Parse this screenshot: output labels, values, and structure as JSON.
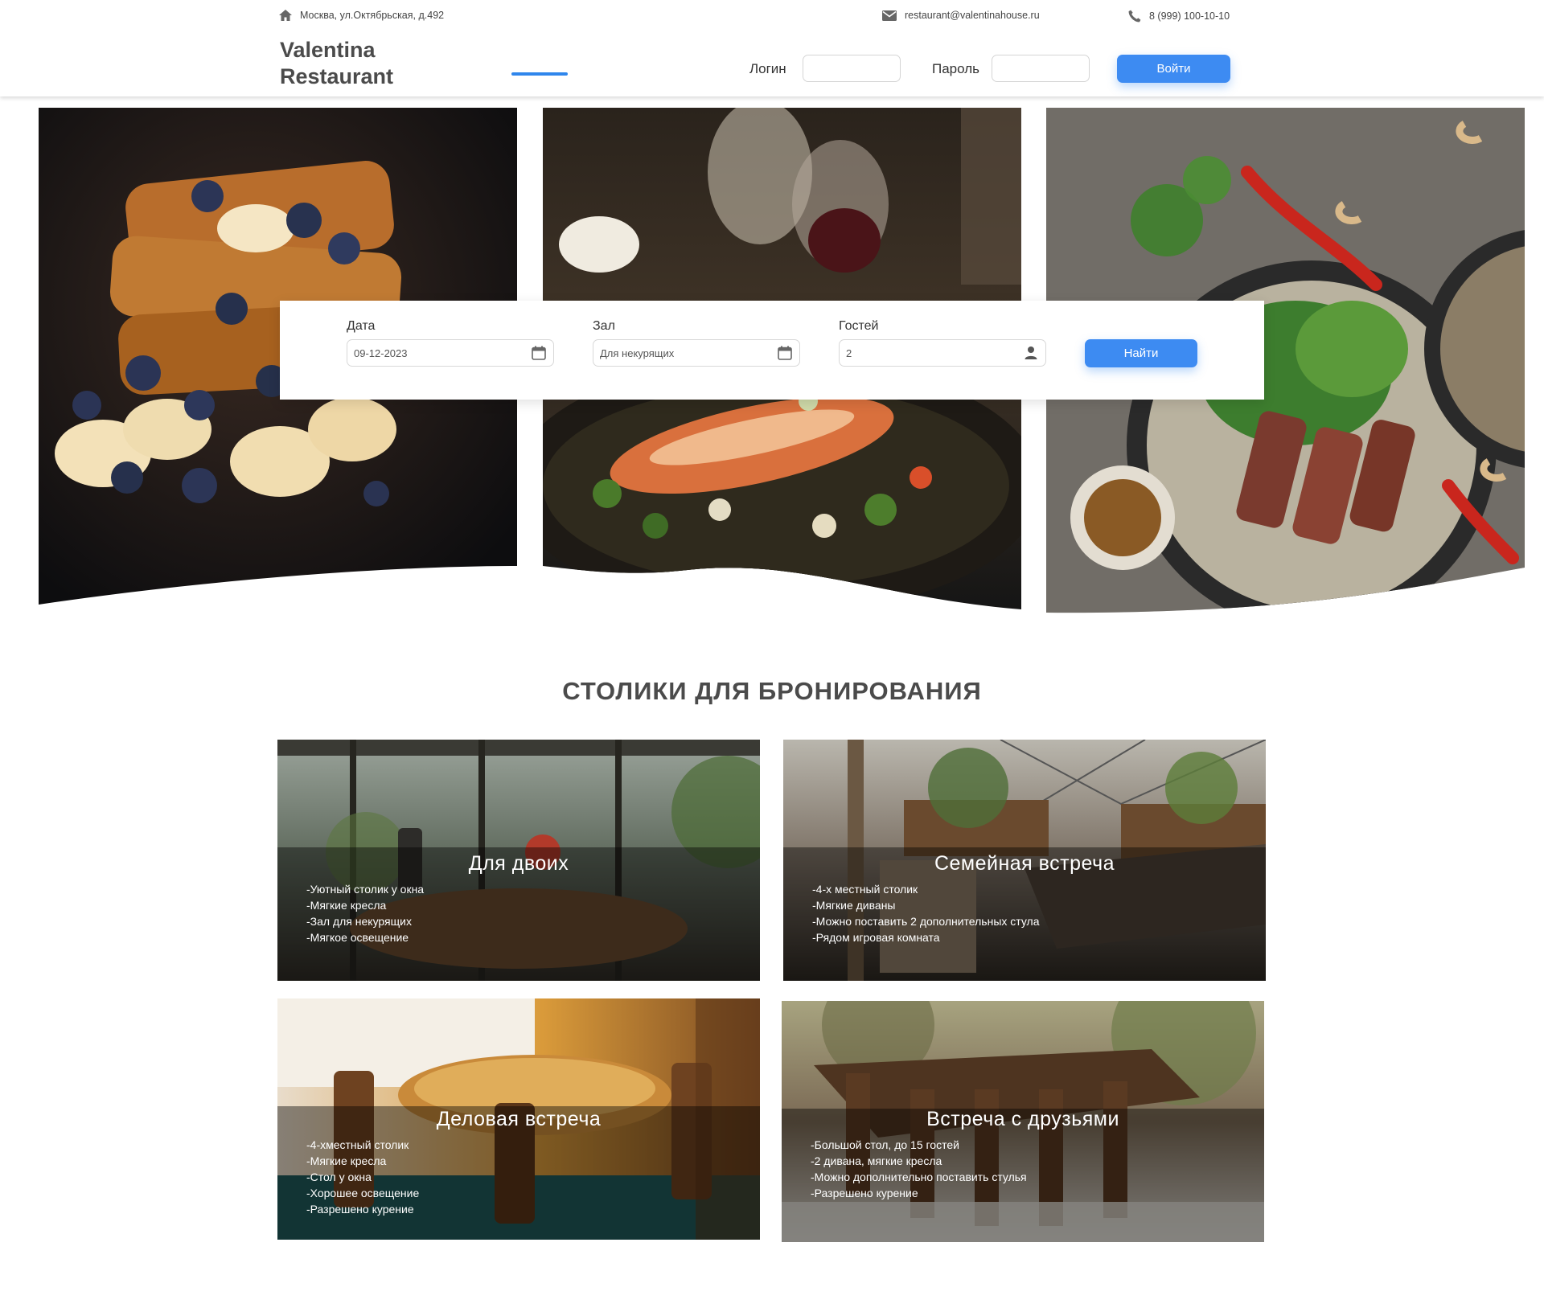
{
  "topbar": {
    "address": "Москва,  ул.Октябрьская, д.492",
    "email": "restaurant@valentinahouse.ru",
    "phone": "8 (999) 100-10-10"
  },
  "header": {
    "brand_line1": "Valentina",
    "brand_line2": "Restaurant",
    "login_label": "Логин",
    "password_label": "Пароль",
    "login_value": "",
    "password_value": "",
    "login_button": "Войти"
  },
  "search": {
    "date_label": "Дата",
    "date_value": "09-12-2023",
    "hall_label": "Зал",
    "hall_value": "Для некурящих",
    "guests_label": "Гостей",
    "guests_value": "2",
    "find_button": "Найти"
  },
  "section": {
    "title": "СТОЛИКИ ДЛЯ БРОНИРОВАНИЯ"
  },
  "tables": [
    {
      "title": "Для двоих",
      "features": [
        "-Уютный столик у окна",
        "-Мягкие кресла",
        "-Зал для некурящих",
        "-Мягкое освещение"
      ]
    },
    {
      "title": "Семейная встреча",
      "features": [
        "-4-х местный столик",
        "-Мягкие диваны",
        "-Можно поставить 2 дополнительных стула",
        "-Рядом игровая комната"
      ]
    },
    {
      "title": "Деловая встреча",
      "features": [
        "-4-хместный столик",
        "-Мягкие кресла",
        "-Стол у окна",
        "-Хорошее освещение",
        "-Разрешено курение"
      ]
    },
    {
      "title": "Встреча с друзьями",
      "features": [
        "-Большой стол, до 15 гостей",
        "-2 дивана, мягкие кресла",
        "-Можно дополнительно поставить стулья",
        "-Разрешено курение"
      ]
    }
  ],
  "colors": {
    "accent": "#3d8bf2",
    "brand_text": "#4b4b4b"
  },
  "icons": [
    "home-icon",
    "mail-icon",
    "phone-icon",
    "calendar-icon",
    "user-icon"
  ]
}
